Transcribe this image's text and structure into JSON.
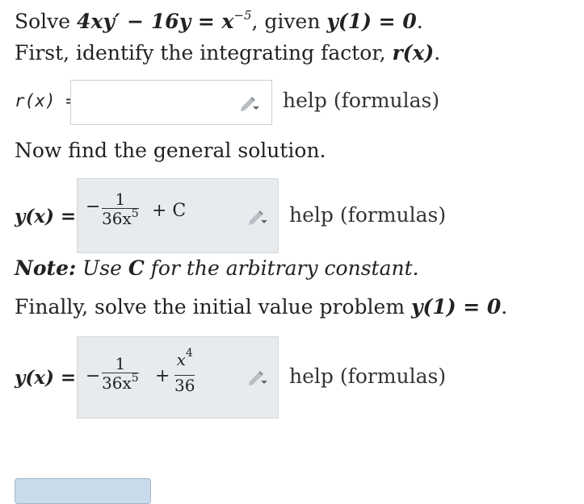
{
  "problem": {
    "prefix": "Solve ",
    "equation": "4xy′ − 16y = x",
    "exponent": "−5",
    "given_text": ", given ",
    "condition": "y(1) = 0",
    "end": "."
  },
  "step1": {
    "prompt_prefix": "First, identify the integrating factor, ",
    "prompt_var": "r(x)",
    "prompt_end": ".",
    "label": "r(x) =",
    "value": "",
    "help": "help (formulas)"
  },
  "step2": {
    "prompt": "Now find the general solution.",
    "label": "y(x) =",
    "neg": "−",
    "frac_num": "1",
    "frac_den": "36x",
    "frac_den_exp": "5",
    "plus_c": "+ C",
    "help": "help (formulas)"
  },
  "note": {
    "bold": "Note:",
    "text_before": " Use ",
    "var": "C",
    "text_after": " for the arbitrary constant."
  },
  "step3": {
    "prompt_prefix": "Finally, solve the initial value problem ",
    "prompt_cond": "y(1) = 0",
    "prompt_end": ".",
    "label": "y(x) =",
    "neg": "−",
    "frac1_num": "1",
    "frac1_den": "36x",
    "frac1_den_exp": "5",
    "plus": "+",
    "frac2_num": "x",
    "frac2_num_exp": "4",
    "frac2_den": "36",
    "help": "help (formulas)"
  },
  "icons": {
    "edit": "pencil-icon"
  }
}
